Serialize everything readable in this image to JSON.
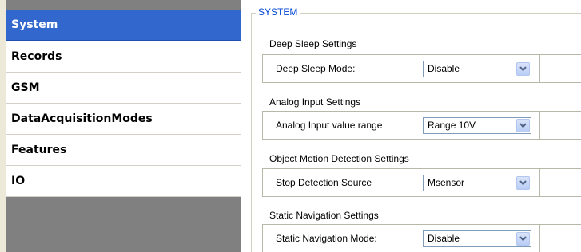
{
  "sidebar": {
    "items": [
      {
        "label": "System",
        "selected": true
      },
      {
        "label": "Records",
        "selected": false
      },
      {
        "label": "GSM",
        "selected": false
      },
      {
        "label": "DataAcquisitionModes",
        "selected": false
      },
      {
        "label": "Features",
        "selected": false
      },
      {
        "label": "IO",
        "selected": false
      }
    ]
  },
  "main": {
    "section_title": "SYSTEM",
    "groups": [
      {
        "title": "Deep Sleep Settings",
        "label": "Deep Sleep Mode:",
        "value": "Disable"
      },
      {
        "title": "Analog Input Settings",
        "label": "Analog Input value range",
        "value": "Range 10V"
      },
      {
        "title": "Object Motion Detection Settings",
        "label": "Stop Detection Source",
        "value": "Msensor"
      },
      {
        "title": "Static Navigation Settings",
        "label": "Static Navigation Mode:",
        "value": "Disable"
      }
    ]
  },
  "colors": {
    "selected_bg": "#3267cd",
    "fieldset_title": "#0046d5",
    "nav_empty_bg": "#808080"
  },
  "icons": {
    "dropdown": "chevron-down-icon"
  }
}
